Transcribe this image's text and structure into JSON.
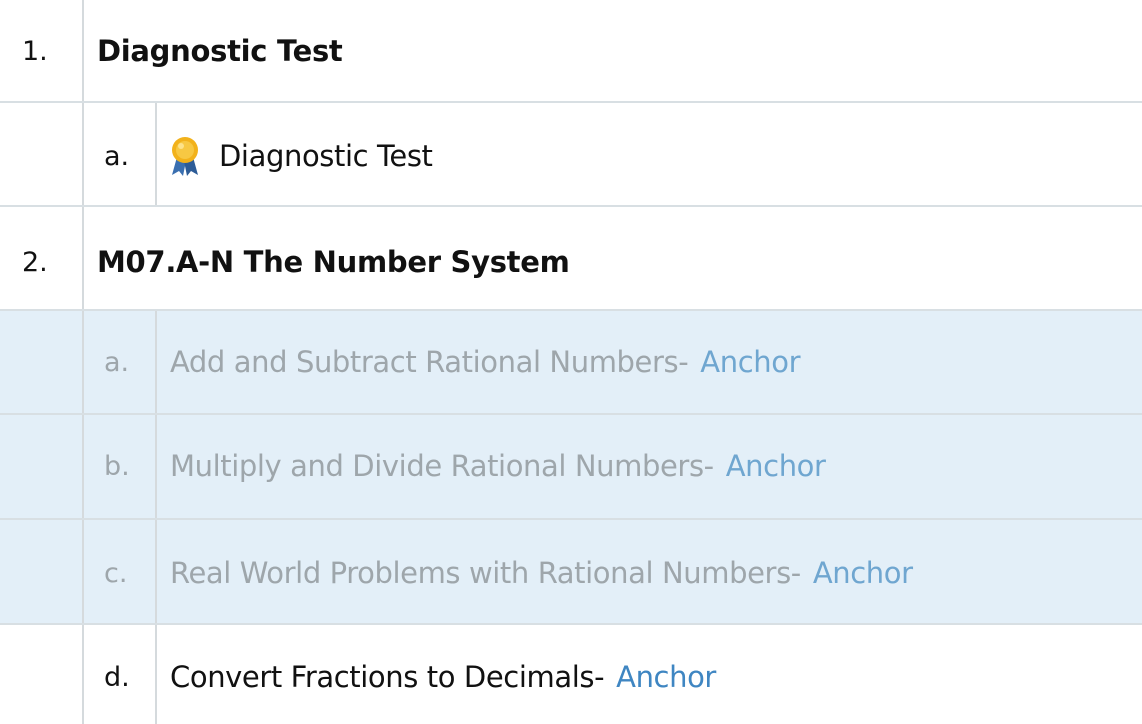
{
  "sections": [
    {
      "number": "1.",
      "title": "Diagnostic Test",
      "items": [
        {
          "letter": "a.",
          "title": "Diagnostic Test",
          "icon": "award-ribbon-icon",
          "link": ""
        }
      ]
    },
    {
      "number": "2.",
      "title": "M07.A-N The Number System",
      "items": [
        {
          "letter": "a.",
          "title": "Add and Subtract Rational Numbers-",
          "link": "Anchor"
        },
        {
          "letter": "b.",
          "title": "Multiply and Divide Rational Numbers-",
          "link": "Anchor"
        },
        {
          "letter": "c.",
          "title": "Real World Problems with Rational Numbers-",
          "link": "Anchor"
        },
        {
          "letter": "d.",
          "title": "Convert Fractions to Decimals-",
          "link": "Anchor"
        }
      ]
    }
  ],
  "colors": {
    "highlight_row": "#e3eff8",
    "link": "#3f86c2",
    "dimmed_text": "#9ea6ab",
    "badge_gold": "#f2b21b",
    "badge_blue": "#3a6fb0"
  }
}
